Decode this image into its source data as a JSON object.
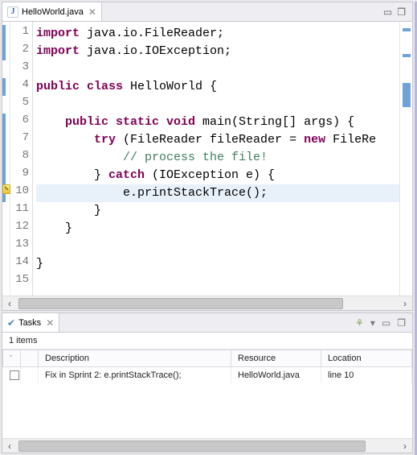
{
  "editor": {
    "tab_title": "HelloWorld.java",
    "lines": [
      {
        "n": "1",
        "seg": [
          {
            "t": "import ",
            "c": "kw"
          },
          {
            "t": "java.io.FileReader;",
            "c": ""
          }
        ]
      },
      {
        "n": "2",
        "seg": [
          {
            "t": "import ",
            "c": "kw"
          },
          {
            "t": "java.io.IOException;",
            "c": ""
          }
        ]
      },
      {
        "n": "3",
        "seg": []
      },
      {
        "n": "4",
        "seg": [
          {
            "t": "public class ",
            "c": "kw"
          },
          {
            "t": "HelloWorld {",
            "c": ""
          }
        ]
      },
      {
        "n": "5",
        "seg": []
      },
      {
        "n": "6",
        "seg": [
          {
            "t": "    ",
            "c": ""
          },
          {
            "t": "public static void ",
            "c": "kw"
          },
          {
            "t": "main(String[] args) {",
            "c": ""
          }
        ]
      },
      {
        "n": "7",
        "seg": [
          {
            "t": "        ",
            "c": ""
          },
          {
            "t": "try ",
            "c": "kw"
          },
          {
            "t": "(FileReader fileReader = ",
            "c": ""
          },
          {
            "t": "new ",
            "c": "kw"
          },
          {
            "t": "FileRe",
            "c": ""
          }
        ]
      },
      {
        "n": "8",
        "seg": [
          {
            "t": "            ",
            "c": ""
          },
          {
            "t": "// process the file!",
            "c": "cm"
          }
        ]
      },
      {
        "n": "9",
        "seg": [
          {
            "t": "        } ",
            "c": ""
          },
          {
            "t": "catch ",
            "c": "kw"
          },
          {
            "t": "(IOException e) {",
            "c": ""
          }
        ]
      },
      {
        "n": "10",
        "hl": true,
        "seg": [
          {
            "t": "            e.printStackTrace();",
            "c": ""
          }
        ]
      },
      {
        "n": "11",
        "seg": [
          {
            "t": "        }",
            "c": ""
          }
        ]
      },
      {
        "n": "12",
        "seg": [
          {
            "t": "    }",
            "c": ""
          }
        ]
      },
      {
        "n": "13",
        "seg": []
      },
      {
        "n": "14",
        "seg": [
          {
            "t": "}",
            "c": ""
          }
        ]
      },
      {
        "n": "15",
        "seg": []
      }
    ]
  },
  "tasks": {
    "tab_title": "Tasks",
    "count_label": "1 items",
    "columns": {
      "c0": "",
      "c1": "",
      "c2": "Description",
      "c3": "Resource",
      "c4": "Location"
    },
    "rows": [
      {
        "description": "Fix in Sprint 2: e.printStackTrace();",
        "resource": "HelloWorld.java",
        "location": "line 10"
      }
    ]
  }
}
